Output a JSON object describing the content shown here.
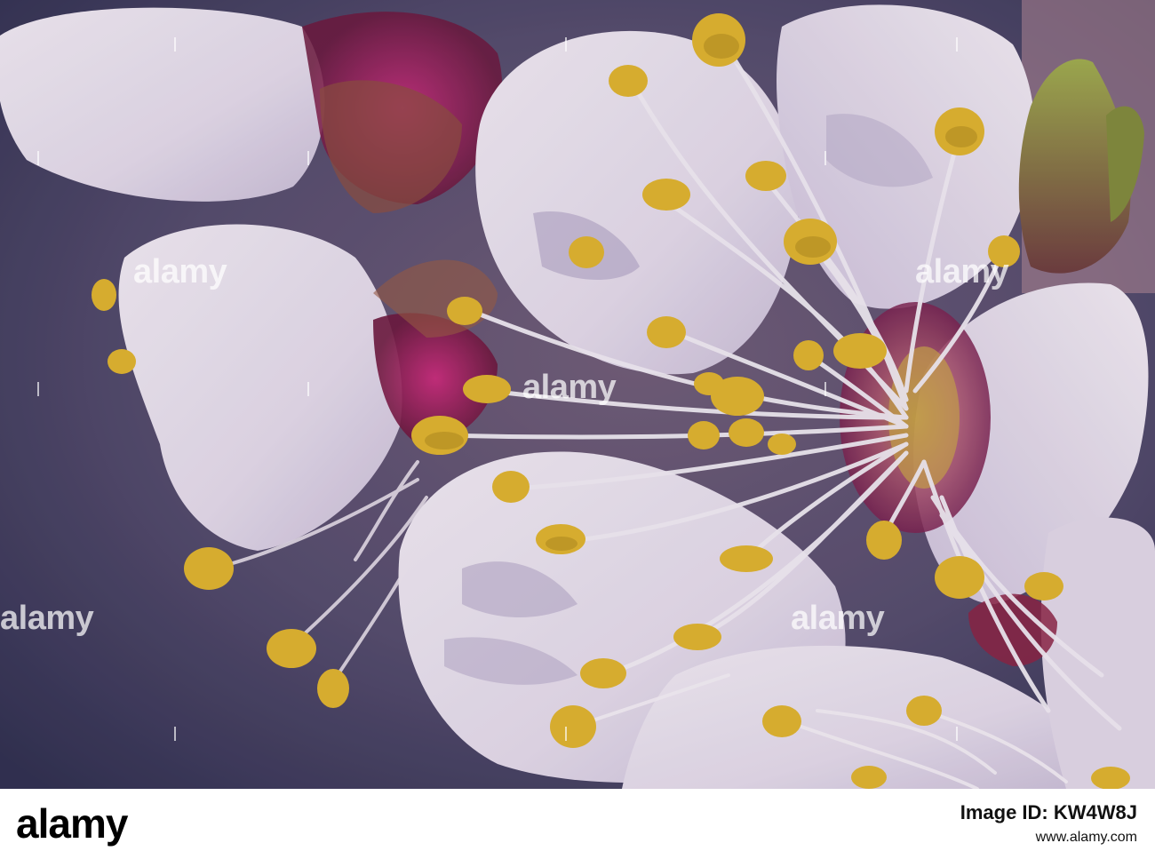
{
  "watermark": {
    "text": "alamy",
    "color": "#ffffff"
  },
  "footer": {
    "logo": "alamy",
    "image_id_label": "Image ID: ",
    "image_id": "KW4W8J",
    "site": "www.alamy.com"
  },
  "colors": {
    "petal": "#e9e2ee",
    "petal_shadow": "#b9aecb",
    "anther": "#e0b52a",
    "center_magenta": "#b3195f",
    "background_dark": "#2a2f4e",
    "bud_green": "#8a9a3a"
  }
}
